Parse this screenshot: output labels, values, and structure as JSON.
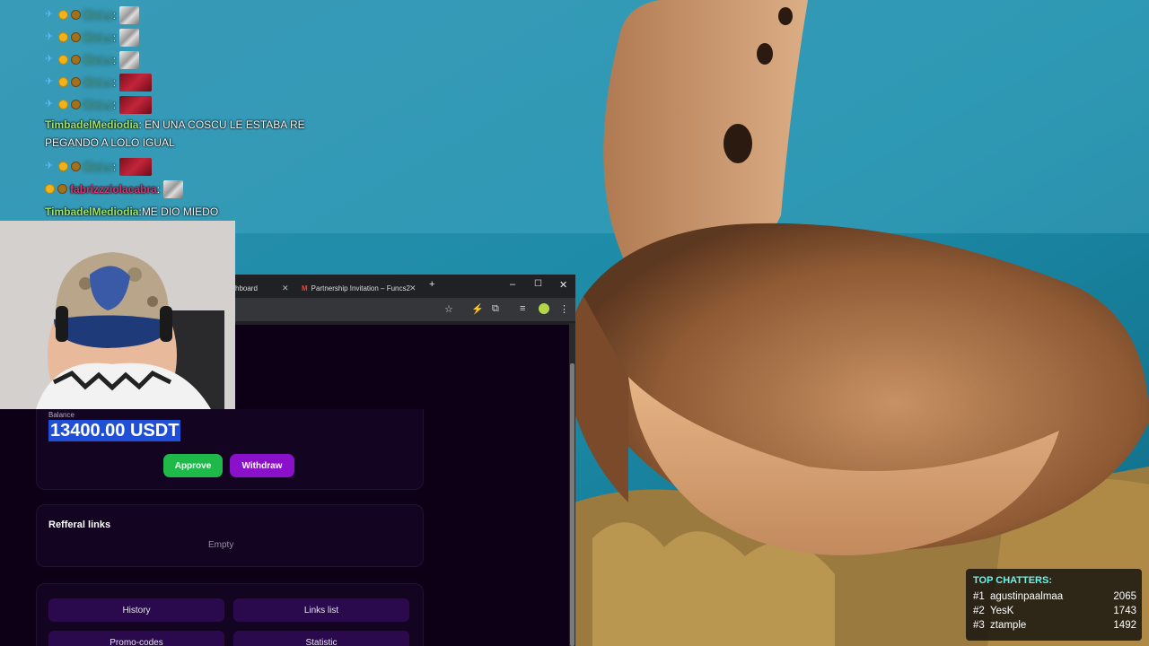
{
  "chat": {
    "lines": [
      {
        "user": "lBeLs",
        "user_color": "#5ad3d0",
        "emote": "gray"
      },
      {
        "user": "lBeLs",
        "user_color": "#5ad3d0",
        "emote": "gray"
      },
      {
        "user": "lBeLs",
        "user_color": "#5ad3d0",
        "emote": "gray"
      },
      {
        "user": "lBeLs",
        "user_color": "#5ad3d0",
        "emote": "red"
      },
      {
        "user": "lBeLs",
        "user_color": "#5ad3d0",
        "emote": "red"
      }
    ],
    "msg1": {
      "user": "TimbadelMediodia",
      "user_color": "#9ee06b",
      "text": "EN UNA COSCU LE ESTABA RE PEGANDO A LOLO IGUAL"
    },
    "line6": {
      "user": "lBeLs",
      "user_color": "#5ad3d0",
      "emote": "red"
    },
    "msg2": {
      "user": "fabrizzziolacabra",
      "user_color": "#e0306b"
    },
    "msg3": {
      "user": "TimbadelMediodia",
      "user_color": "#9ee06b",
      "text": "ME DIO MIEDO"
    }
  },
  "browser": {
    "tab1_label": "hboard",
    "tab2_icon": "M",
    "tab2_label": "Partnership Invitation – Funcs2",
    "tab_close": "✕",
    "new_tab": "+",
    "minimize": "–",
    "maximize": "☐",
    "close": "✕"
  },
  "dashboard": {
    "balance_label": "Balance",
    "balance_value": "13400.00 USDT",
    "approve_label": "Approve",
    "withdraw_label": "Withdraw",
    "referral_title": "Refferal links",
    "referral_empty": "Empty",
    "menu": [
      "History",
      "Links list",
      "Promo-codes",
      "Statistic"
    ]
  },
  "top_chatters": {
    "title": "TOP CHATTERS:",
    "rows": [
      {
        "rank": "#1",
        "name": "agustinpaalmaa",
        "count": "2065"
      },
      {
        "rank": "#2",
        "name": "YesK",
        "count": "1743"
      },
      {
        "rank": "#3",
        "name": "ztample",
        "count": "1492"
      }
    ]
  },
  "colors": {
    "page_bg": "#0d0016",
    "approve": "#1fb94a",
    "withdraw": "#8a10c9",
    "menu_button": "#2a0a4c",
    "selection": "#1e4fd6",
    "top_chatters_title": "#6ef3e8"
  }
}
